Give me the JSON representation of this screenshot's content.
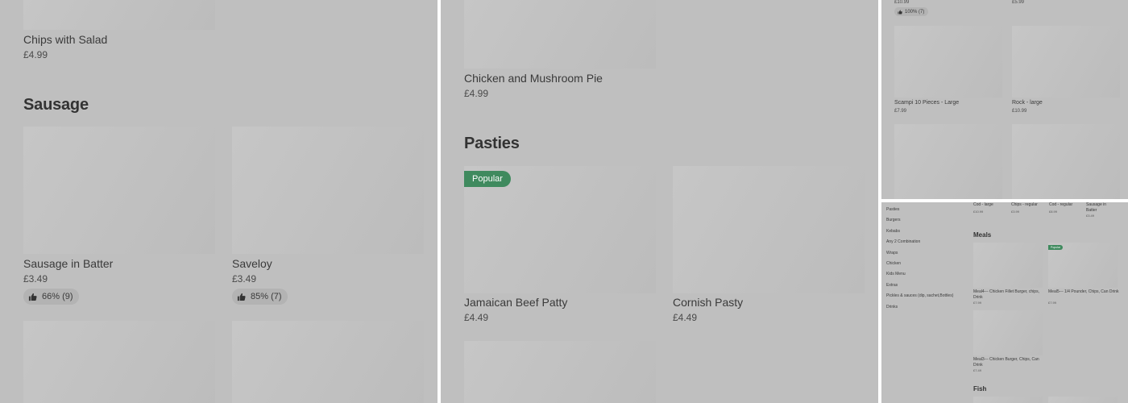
{
  "panel1": {
    "top_item": {
      "name": "Chips with Salad",
      "price": "£4.99"
    },
    "section_title": "Sausage",
    "items": [
      {
        "name": "Sausage in Batter",
        "price": "£3.49",
        "rating": "66% (9)"
      },
      {
        "name": "Saveloy",
        "price": "£3.49",
        "rating": "85% (7)"
      }
    ]
  },
  "panel2": {
    "top_item": {
      "name": "Chicken and Mushroom Pie",
      "price": "£4.99"
    },
    "section_title": "Pasties",
    "badge": "Popular",
    "items": [
      {
        "name": "Jamaican Beef Patty",
        "price": "£4.49"
      },
      {
        "name": "Cornish Pasty",
        "price": "£4.49"
      }
    ]
  },
  "panel3": {
    "top_prices": [
      "£10.99",
      "£5.99"
    ],
    "top_rating": "100% (7)",
    "items": [
      {
        "name": "Scampi 10 Pieces - Large",
        "price": "£7.99"
      },
      {
        "name": "Rock - large",
        "price": "£10.99"
      }
    ]
  },
  "panel4": {
    "sidebar": [
      "Pasties",
      "Burgers",
      "Kebabs",
      "Any 2 Combination",
      "Wraps",
      "Chicken",
      "Kids Menu",
      "Extras",
      "Pickles & sauces (dip, sachet,Bottles)",
      "Drinks"
    ],
    "top_row": [
      {
        "name": "Cod - large",
        "price": "£10.99"
      },
      {
        "name": "Chips - regular",
        "price": "£3.99"
      },
      {
        "name": "Cod - regular",
        "price": "£8.99"
      },
      {
        "name": "Sausage in Batter",
        "price": "£3.49"
      }
    ],
    "meals_title": "Meals",
    "badge": "Popular",
    "meals": [
      {
        "name": "Meal4--- Chicken Fillet Burger, chips, Drink",
        "price": "£7.99"
      },
      {
        "name": "Meal5--- 1/4 Pounder, Chips, Can Drink",
        "price": "£7.99"
      },
      {
        "name": "Meal3--- Chicken Burger, Chips, Can Drink",
        "price": "£7.49"
      }
    ],
    "fish_title": "Fish"
  }
}
